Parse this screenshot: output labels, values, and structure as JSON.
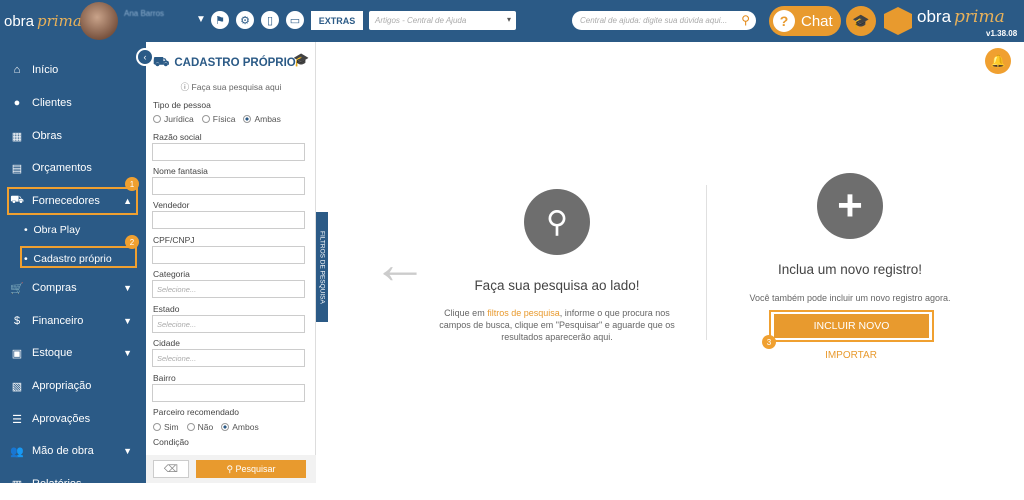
{
  "topbar": {
    "logo_text": "obra",
    "logo_brand": "prima",
    "user_name": "Ana Barros",
    "extras_label": "EXTRAS",
    "artigos_placeholder": "Artigos - Central de Ajuda",
    "search_placeholder": "Central de ajuda: digite sua dúvida aqui...",
    "chat_label": "Chat",
    "brand_text": "obra",
    "brand_italic": "prima",
    "version": "v1.38.08"
  },
  "sidebar": {
    "items": [
      {
        "label": "Início",
        "icon": "home-icon"
      },
      {
        "label": "Clientes",
        "icon": "user-icon"
      },
      {
        "label": "Obras",
        "icon": "building-icon"
      },
      {
        "label": "Orçamentos",
        "icon": "document-icon"
      },
      {
        "label": "Fornecedores",
        "icon": "truck-icon"
      },
      {
        "label": "Compras",
        "icon": "cart-icon"
      },
      {
        "label": "Financeiro",
        "icon": "dollar-icon"
      },
      {
        "label": "Estoque",
        "icon": "box-icon"
      },
      {
        "label": "Apropriação",
        "icon": "file-icon"
      },
      {
        "label": "Aprovações",
        "icon": "list-check-icon"
      },
      {
        "label": "Mão de obra",
        "icon": "workers-icon"
      },
      {
        "label": "Relatórios",
        "icon": "report-icon"
      }
    ],
    "submenu": [
      "Obra Play",
      "Cadastro próprio"
    ],
    "badges": [
      "1",
      "2",
      "3"
    ]
  },
  "filter": {
    "title": "CADASTRO PRÓPRIO",
    "hint": "Faça sua pesquisa aqui",
    "tipo_label": "Tipo de pessoa",
    "tipo_options": [
      "Jurídica",
      "Física",
      "Ambas"
    ],
    "razao_label": "Razão social",
    "fantasia_label": "Nome fantasia",
    "vendedor_label": "Vendedor",
    "cpf_label": "CPF/CNPJ",
    "categoria_label": "Categoria",
    "estado_label": "Estado",
    "cidade_label": "Cidade",
    "bairro_label": "Bairro",
    "select_placeholder": "Selecione...",
    "parceiro_label": "Parceiro recomendado",
    "parceiro_options": [
      "Sim",
      "Não",
      "Ambos"
    ],
    "condicao_label": "Condição",
    "pesquisar_label": "Pesquisar",
    "side_tab": "FILTROS DE PESQUISA"
  },
  "main": {
    "left_title": "Faça sua pesquisa ao lado!",
    "left_p1": "Clique em ",
    "left_link": "filtros de pesquisa",
    "left_p2": ", informe o que procura nos campos de busca, clique em \"Pesquisar\" e aguarde que os resultados aparecerão aqui.",
    "right_title": "Inclua um novo registro!",
    "right_text": "Você também pode incluir um novo registro agora.",
    "incluir_label": "INCLUIR NOVO",
    "importar_label": "IMPORTAR"
  },
  "colors": {
    "primary": "#2b5a86",
    "accent": "#e89a2e",
    "highlight": "#f0a030"
  }
}
